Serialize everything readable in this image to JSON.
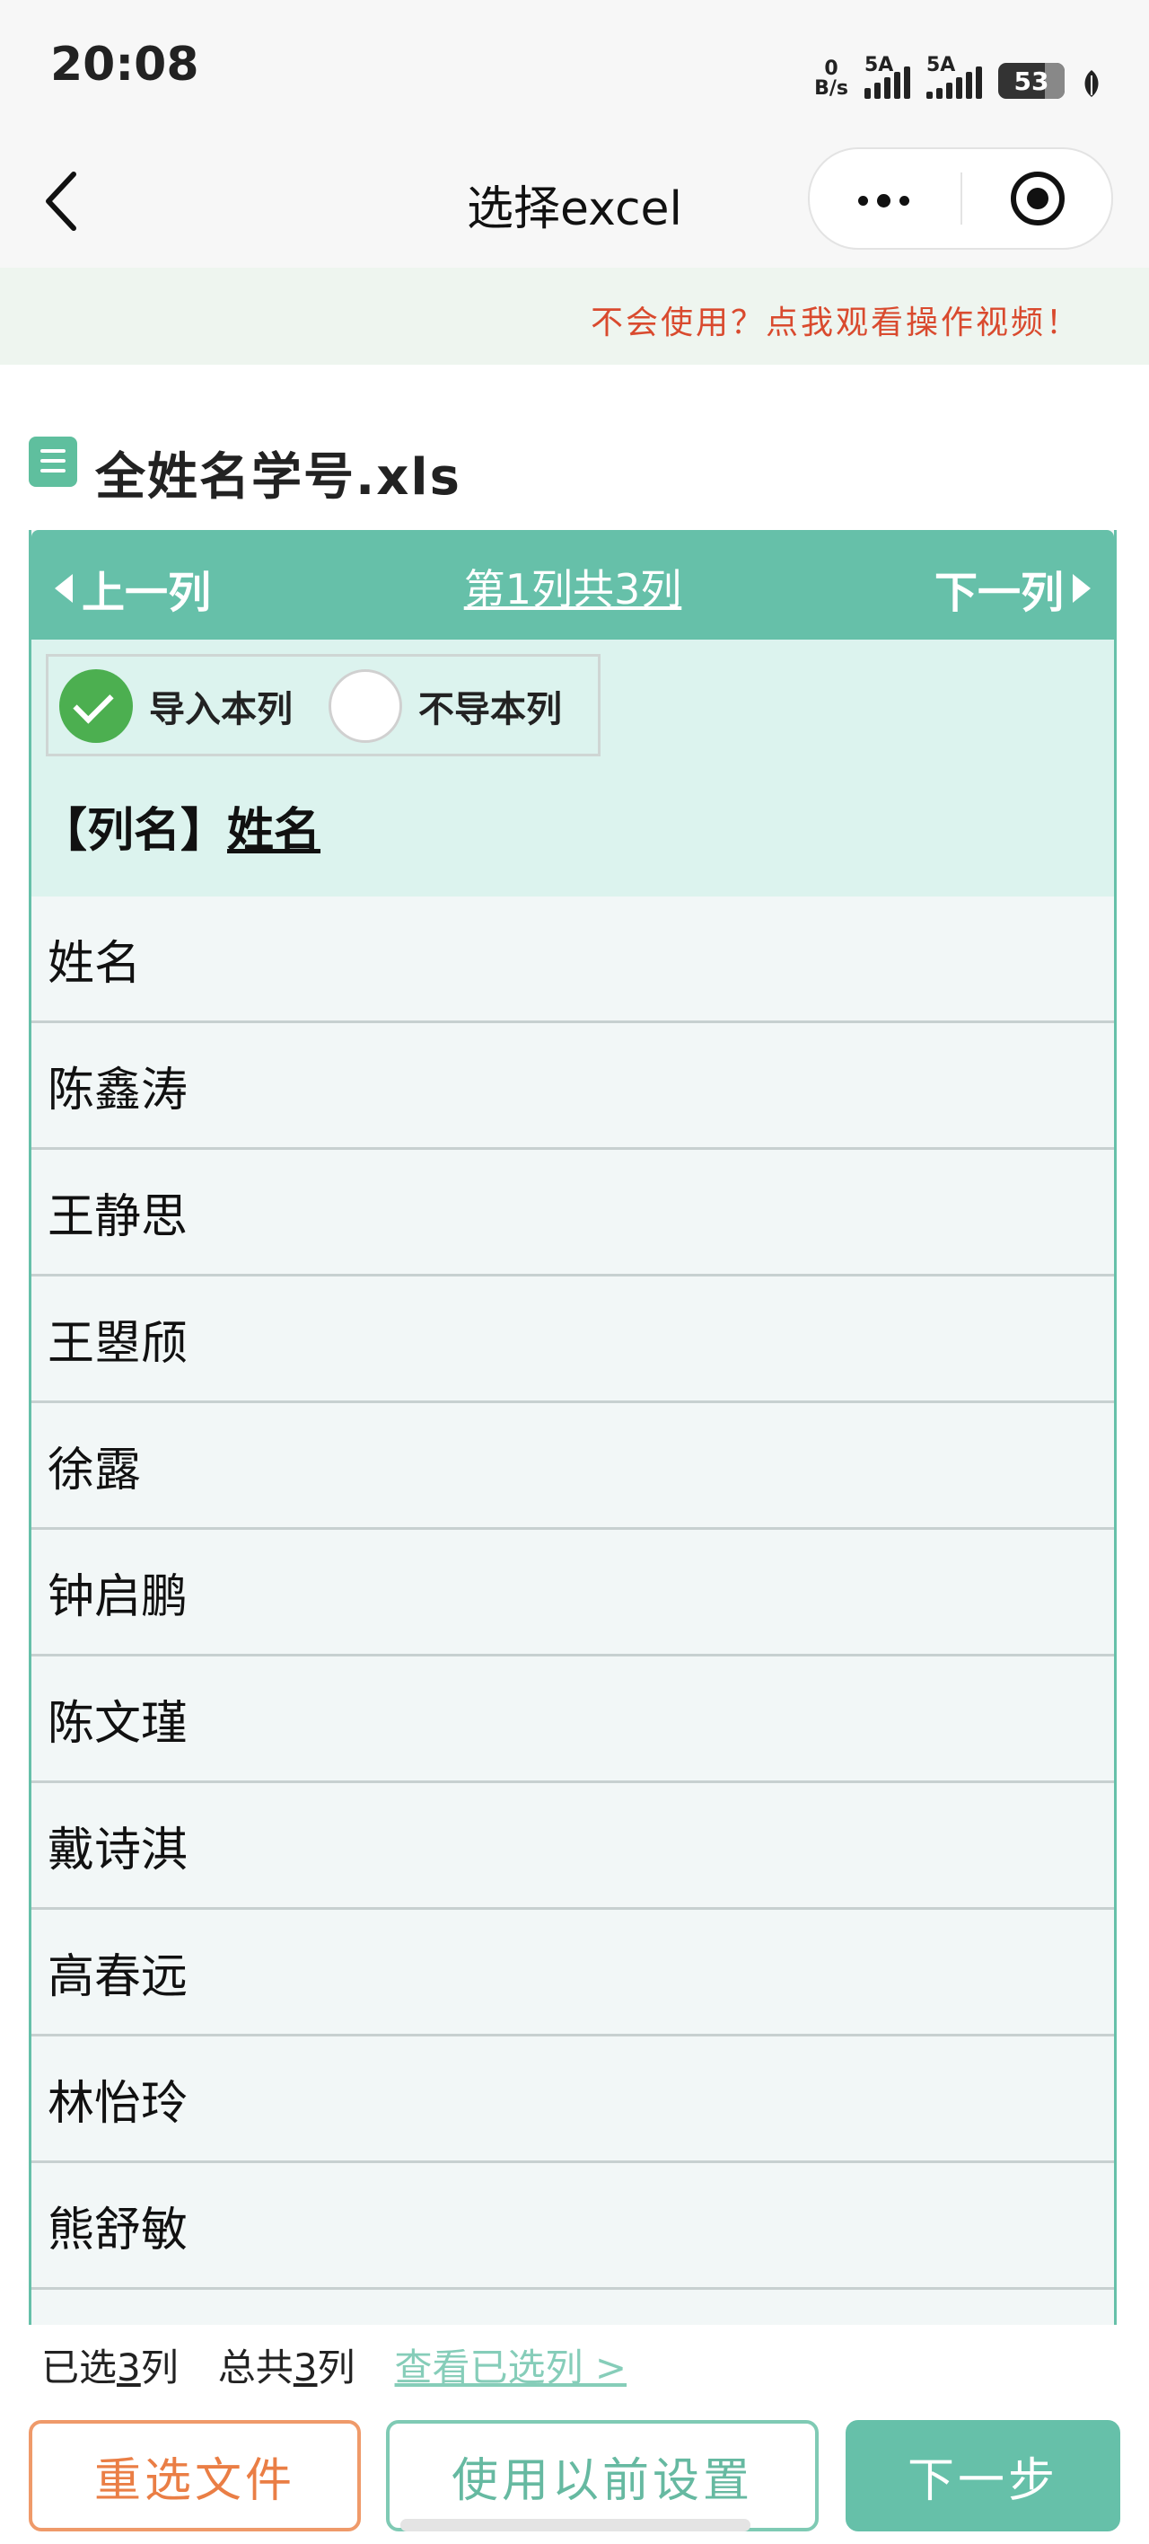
{
  "status_bar": {
    "time": "20:08",
    "net_speed_value": "0",
    "net_speed_unit": "B/s",
    "sim1_label": "5A",
    "sim2_label": "5A",
    "battery": "53"
  },
  "nav": {
    "title": "选择excel",
    "icons": [
      "back-arrow-icon",
      "more-dots-icon",
      "target-circle-icon"
    ]
  },
  "help": {
    "link_text": "不会使用？点我观看操作视频！"
  },
  "file": {
    "name": "全姓名学号.xls",
    "icon": "spreadsheet-icon"
  },
  "column_nav": {
    "prev_label": "上一列",
    "position_label": "第1列共3列",
    "next_label": "下一列"
  },
  "import_options": {
    "import_label": "导入本列",
    "skip_label": "不导本列",
    "selected": "import"
  },
  "column_header": {
    "prefix": "【列名】",
    "name": "姓名"
  },
  "rows": [
    "姓名",
    "陈鑫涛",
    "王静思",
    "王曌颀",
    "徐露",
    "钟启鹏",
    "陈文瑾",
    "戴诗淇",
    "高春远",
    "林怡玲",
    "熊舒敏"
  ],
  "footer": {
    "selected_prefix": "已选",
    "selected_count": "3",
    "selected_suffix": "列",
    "total_prefix": "总共",
    "total_count": "3",
    "total_suffix": "列",
    "view_selected": "查看已选列 >",
    "reselect_button": "重选文件",
    "previous_settings_button": "使用以前设置",
    "next_button": "下一步"
  },
  "colors": {
    "accent": "#66c0a9",
    "check_green": "#4caf50",
    "help_text": "#d94a2e",
    "reselect_orange": "#ea7e45"
  }
}
